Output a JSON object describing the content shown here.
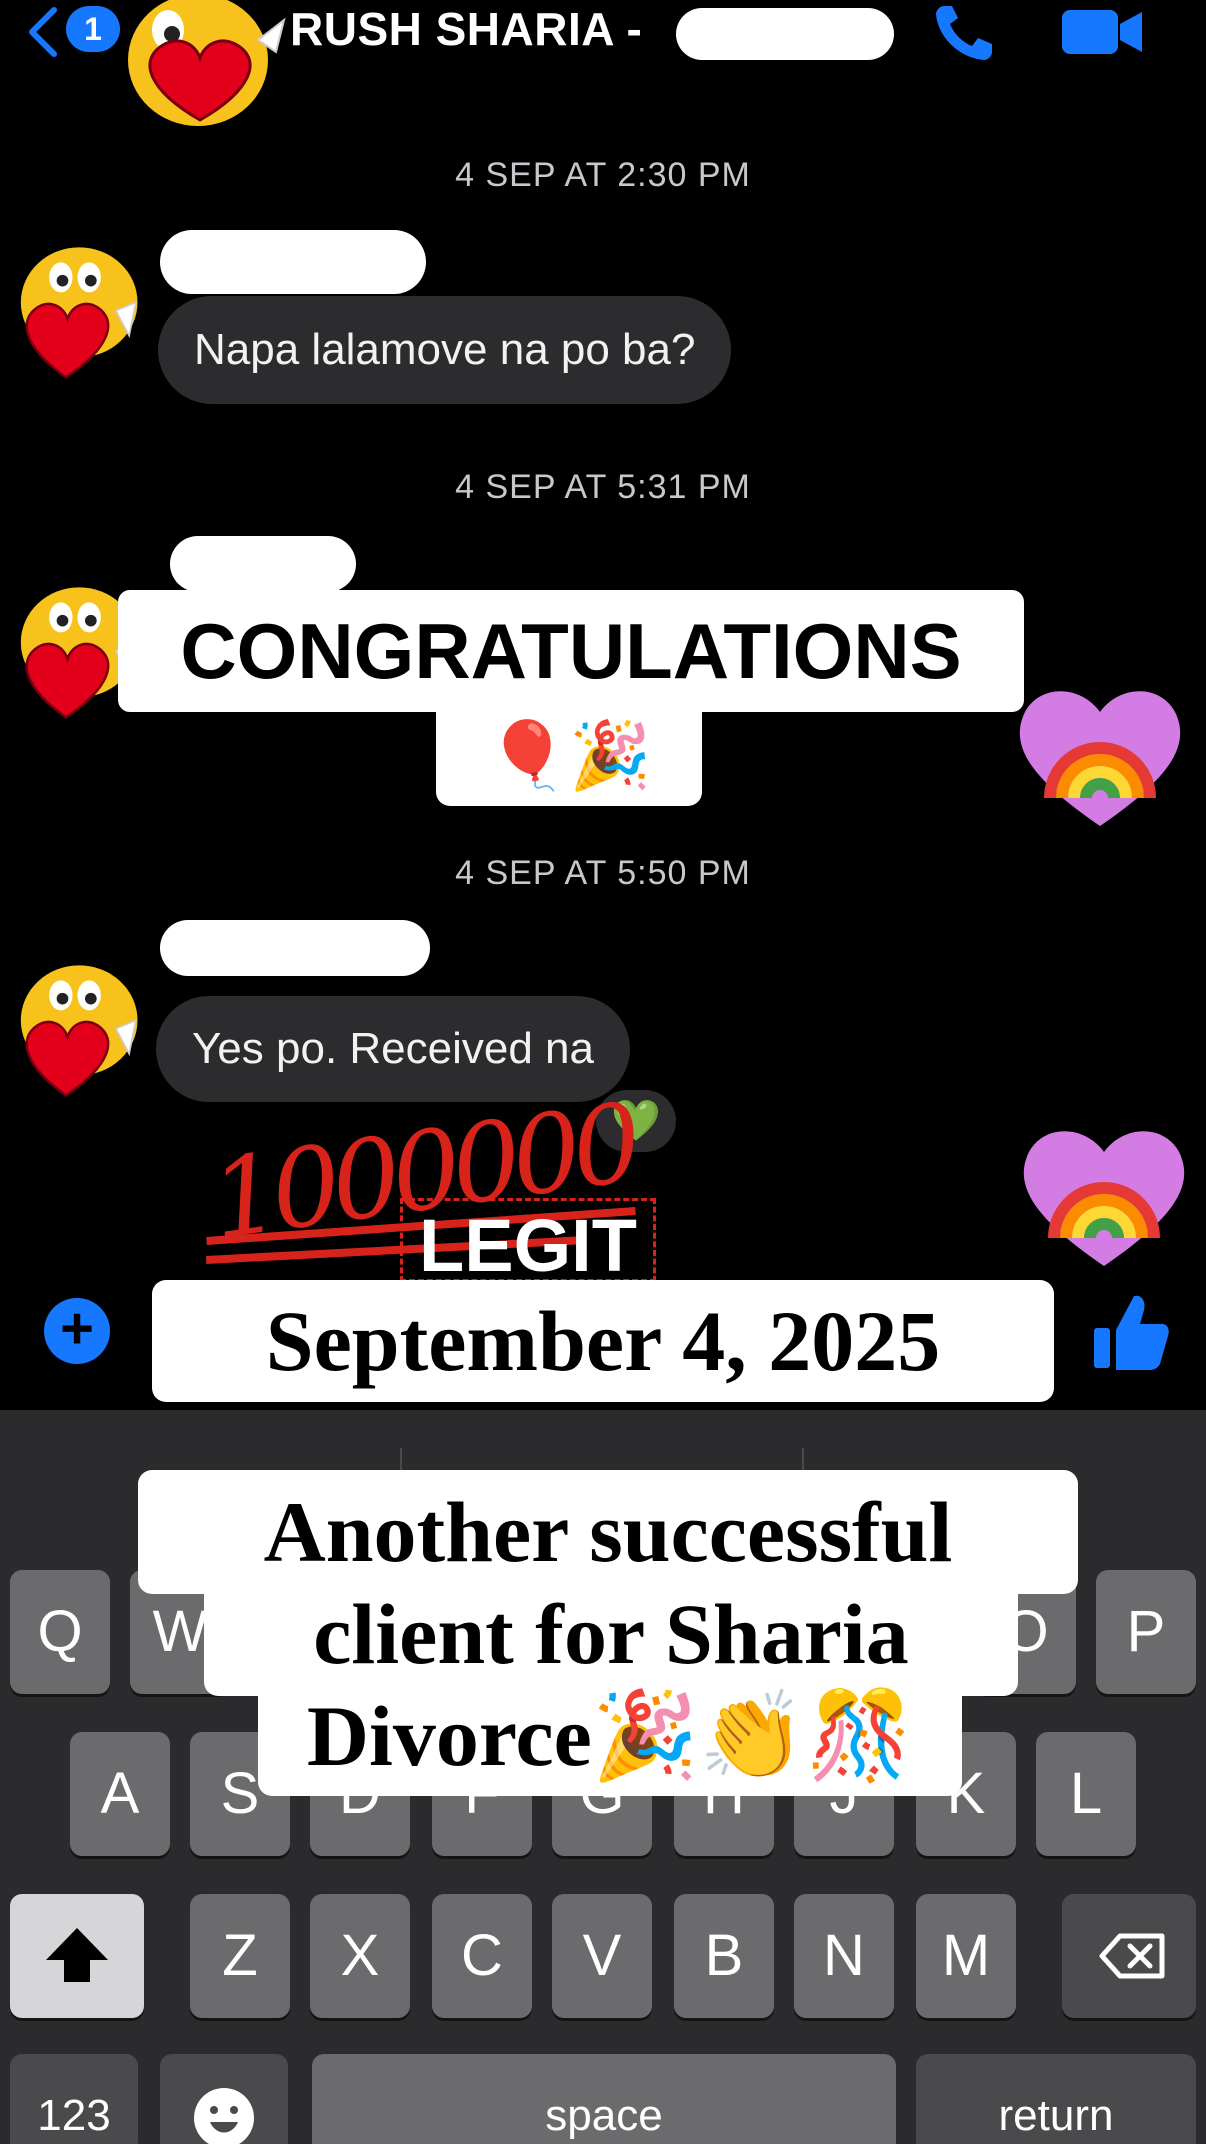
{
  "header": {
    "back_count": "1",
    "title": "RUSH SHARIA -",
    "title_suffix": "/...",
    "icons": [
      "back-chevron-icon",
      "phone-icon",
      "video-icon"
    ]
  },
  "messages": [
    {
      "timestamp": "4 SEP AT 2:30 PM",
      "text": "Napa lalamove na po ba?"
    },
    {
      "timestamp": "4 SEP AT 5:31 PM",
      "text": "CONGRATULATIONS",
      "emojis": "🎈🎉"
    },
    {
      "timestamp": "4 SEP AT 5:50 PM",
      "text": "Yes po. Received na",
      "reaction": "💚"
    }
  ],
  "stickers": {
    "hundred": "1000000",
    "legit": "LEGIT"
  },
  "overlays": {
    "date": "September 4, 2025",
    "caption_line1": "Another successful",
    "caption_line2": "client for Sharia",
    "caption_line3": "Divorce🎉👏🎊"
  },
  "keyboard": {
    "row1": [
      "Q",
      "W",
      "O",
      "P"
    ],
    "row2": [
      "A",
      "S",
      "D",
      "F",
      "G",
      "H",
      "J",
      "K",
      "L"
    ],
    "row3": [
      "Z",
      "X",
      "C",
      "V",
      "B",
      "N",
      "M"
    ],
    "numbers_key": "123",
    "space_key": "space",
    "return_key": "return"
  },
  "colors": {
    "accent": "#1677ff",
    "bubble": "#2c2c2e",
    "keyboard_bg": "#2b2b2d",
    "key": "#6b6b6e"
  }
}
